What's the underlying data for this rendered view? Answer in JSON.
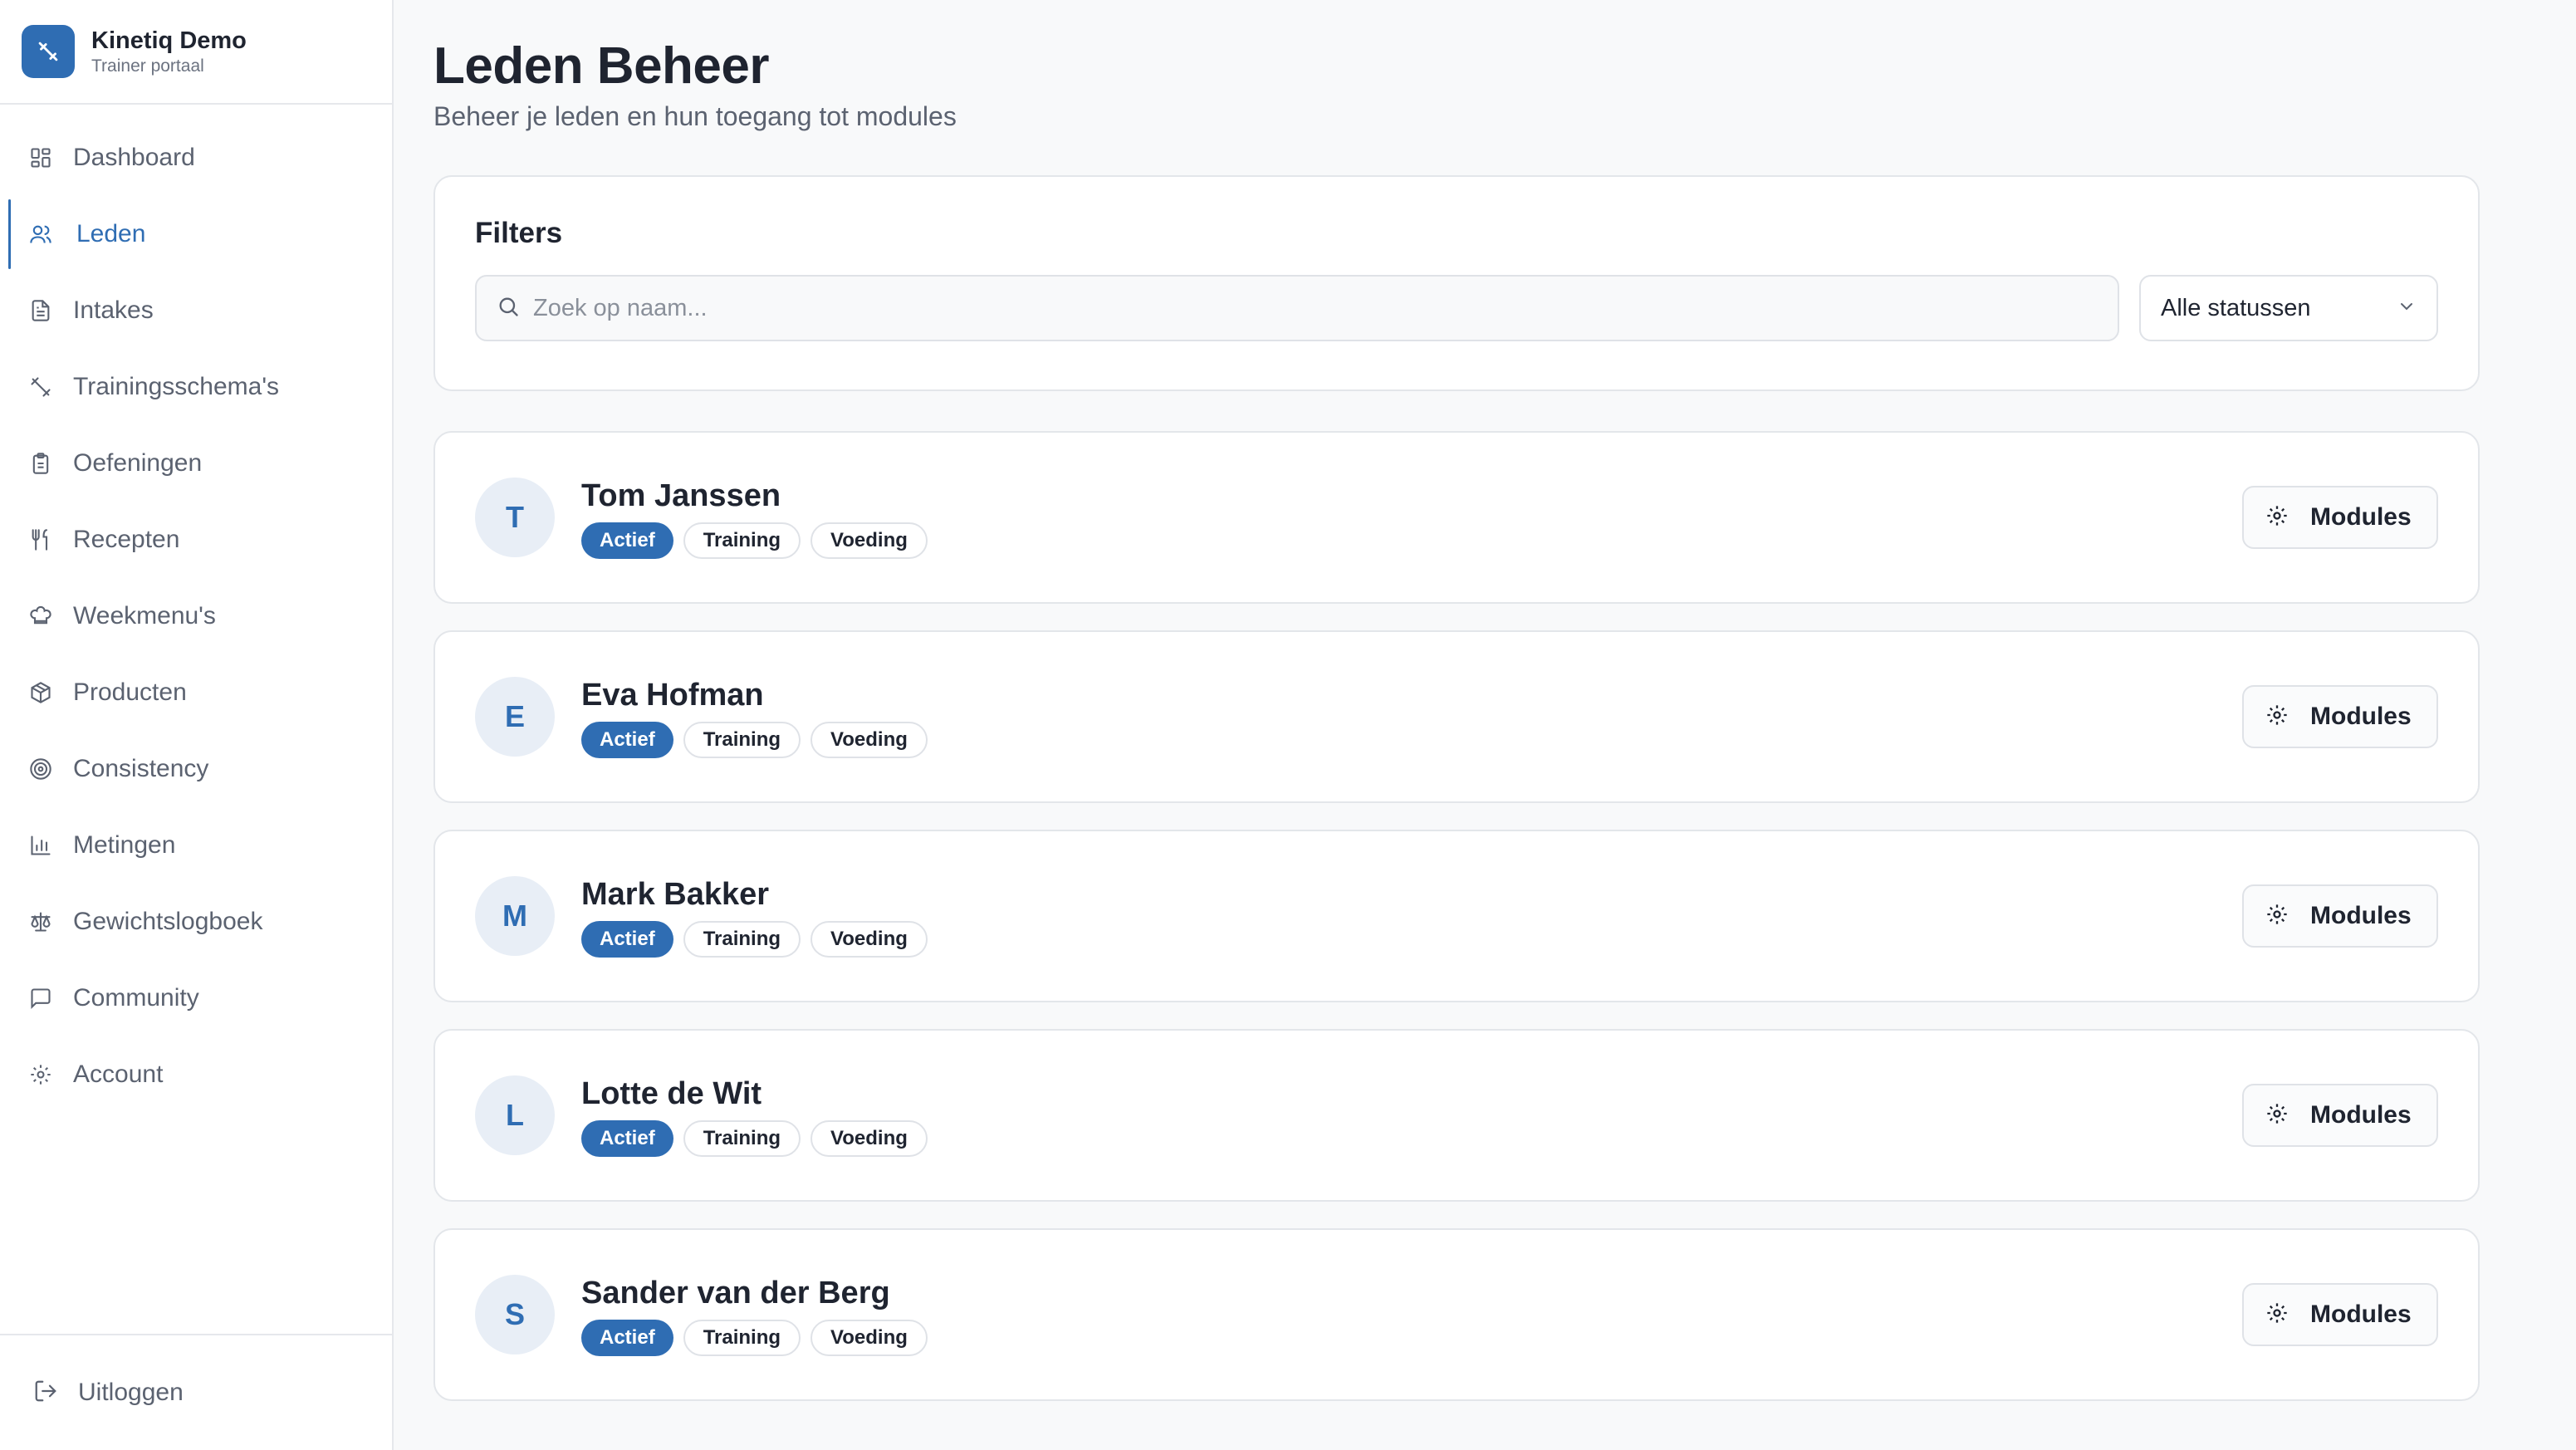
{
  "brand": {
    "name": "Kinetiq Demo",
    "subtitle": "Trainer portaal"
  },
  "sidebar": {
    "items": [
      {
        "label": "Dashboard",
        "icon": "dashboard-icon"
      },
      {
        "label": "Leden",
        "icon": "users-icon",
        "active": true
      },
      {
        "label": "Intakes",
        "icon": "file-text-icon"
      },
      {
        "label": "Trainingsschema's",
        "icon": "dumbbell-icon"
      },
      {
        "label": "Oefeningen",
        "icon": "clipboard-icon"
      },
      {
        "label": "Recepten",
        "icon": "utensils-icon"
      },
      {
        "label": "Weekmenu's",
        "icon": "chef-hat-icon"
      },
      {
        "label": "Producten",
        "icon": "package-icon"
      },
      {
        "label": "Consistency",
        "icon": "target-icon"
      },
      {
        "label": "Metingen",
        "icon": "bar-chart-icon"
      },
      {
        "label": "Gewichtslogboek",
        "icon": "scale-icon"
      },
      {
        "label": "Community",
        "icon": "message-icon"
      },
      {
        "label": "Account",
        "icon": "gear-icon"
      }
    ],
    "logout_label": "Uitloggen"
  },
  "page": {
    "title": "Leden Beheer",
    "subtitle": "Beheer je leden en hun toegang tot modules"
  },
  "filters": {
    "title": "Filters",
    "search_placeholder": "Zoek op naam...",
    "search_value": "",
    "status_select": "Alle statussen"
  },
  "members": [
    {
      "initial": "T",
      "name": "Tom Janssen",
      "status": "Actief",
      "modules": [
        "Training",
        "Voeding"
      ],
      "action": "Modules"
    },
    {
      "initial": "E",
      "name": "Eva Hofman",
      "status": "Actief",
      "modules": [
        "Training",
        "Voeding"
      ],
      "action": "Modules"
    },
    {
      "initial": "M",
      "name": "Mark Bakker",
      "status": "Actief",
      "modules": [
        "Training",
        "Voeding"
      ],
      "action": "Modules"
    },
    {
      "initial": "L",
      "name": "Lotte de Wit",
      "status": "Actief",
      "modules": [
        "Training",
        "Voeding"
      ],
      "action": "Modules"
    },
    {
      "initial": "S",
      "name": "Sander van der Berg",
      "status": "Actief",
      "modules": [
        "Training",
        "Voeding"
      ],
      "action": "Modules"
    }
  ],
  "colors": {
    "accent": "#2f6db3",
    "text": "#1f2430",
    "muted": "#5b6270"
  }
}
